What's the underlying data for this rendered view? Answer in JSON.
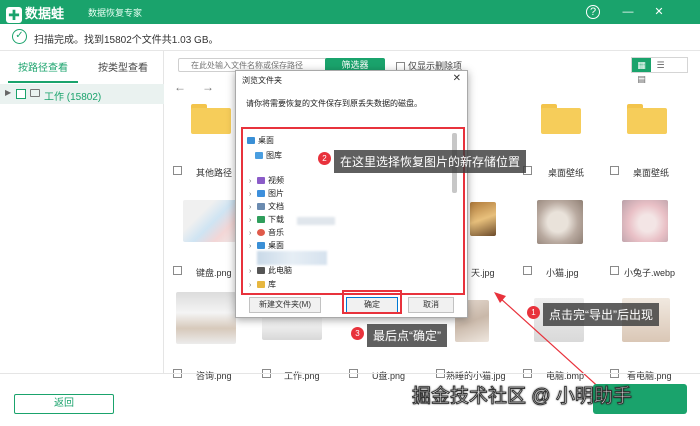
{
  "app": {
    "logo_text": "数据蛙",
    "subtitle": "数据恢复专家",
    "help_icon": "?",
    "min_icon": "—",
    "close_icon": "✕",
    "brand_color": "#1aa36c"
  },
  "status": {
    "text": "扫描完成。找到15802个文件共1.03 GB。"
  },
  "left_panel": {
    "tabs": [
      "按路径查看",
      "按类型查看"
    ],
    "tree_label": "工作 (15802)"
  },
  "toolbar": {
    "search_placeholder": "在此处输入文件名称或保存路径",
    "filter_label": "筛选器",
    "only_deleted_label": "仅显示删除项"
  },
  "files": {
    "row1": [
      "其他路径",
      "桌面壁纸",
      "桌面壁纸"
    ],
    "row2": [
      "键盘.png",
      "天.jpg",
      "小猫.jpg",
      "小兔子.webp"
    ],
    "row3": [
      "咨询.png",
      "工作.png",
      "U盘.png",
      "熟睡的小猫.jpg",
      "电脑.bmp",
      "看电脑.png"
    ]
  },
  "dialog": {
    "title": "浏览文件夹",
    "message": "请你将需要恢复的文件保存到原丢失数据的磁盘。",
    "tree": [
      "桌面",
      "图库",
      "视频",
      "图片",
      "文档",
      "下载",
      "音乐",
      "桌面",
      "此电脑",
      "库"
    ],
    "new_folder": "新建文件夹(M)",
    "ok": "确定",
    "cancel": "取消"
  },
  "annotations": {
    "step1_num": "1",
    "step1_text": "点击完“导出”后出现",
    "step2_num": "2",
    "step2_text": "在这里选择恢复图片的新存储位置",
    "step3_num": "3",
    "step3_text": "最后点“确定”",
    "accent": "#e8323c"
  },
  "bottom": {
    "back_label": "返回",
    "watermark": "掘金技术社区 @ 小明助手"
  }
}
